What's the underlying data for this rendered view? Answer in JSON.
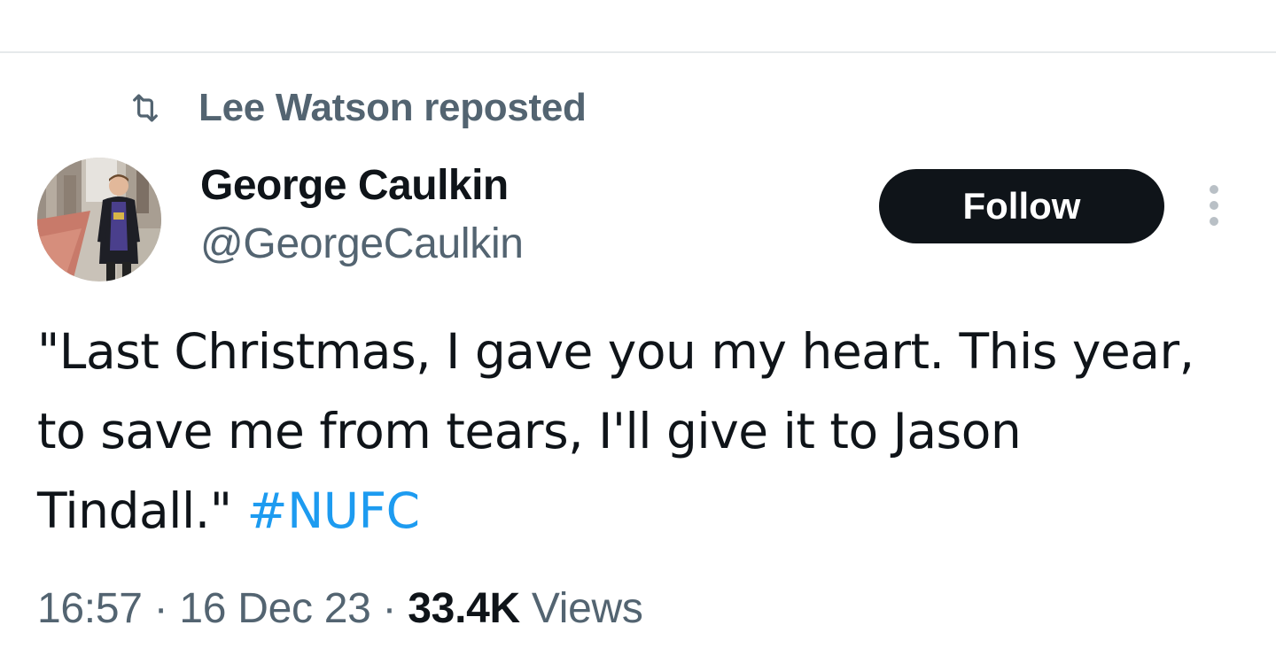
{
  "repost": {
    "icon": "repost-icon",
    "label": "Lee Watson reposted"
  },
  "author": {
    "avatar_icon": "avatar",
    "display_name": "George Caulkin",
    "handle": "@GeorgeCaulkin"
  },
  "actions": {
    "follow_label": "Follow",
    "more_icon": "more-vertical-icon"
  },
  "tweet": {
    "text": "\"Last Christmas, I gave you my heart. This year, to save me from tears, I'll give it to Jason Tindall.\"",
    "hashtag": "#NUFC"
  },
  "meta": {
    "time": "16:57",
    "separator1": " · ",
    "date": "16 Dec 23",
    "separator2": " · ",
    "views_count": "33.4K",
    "views_label": "Views"
  },
  "colors": {
    "text_primary": "#0f1419",
    "text_secondary": "#536471",
    "link": "#1d9bf0",
    "follow_bg": "#0f1419"
  }
}
